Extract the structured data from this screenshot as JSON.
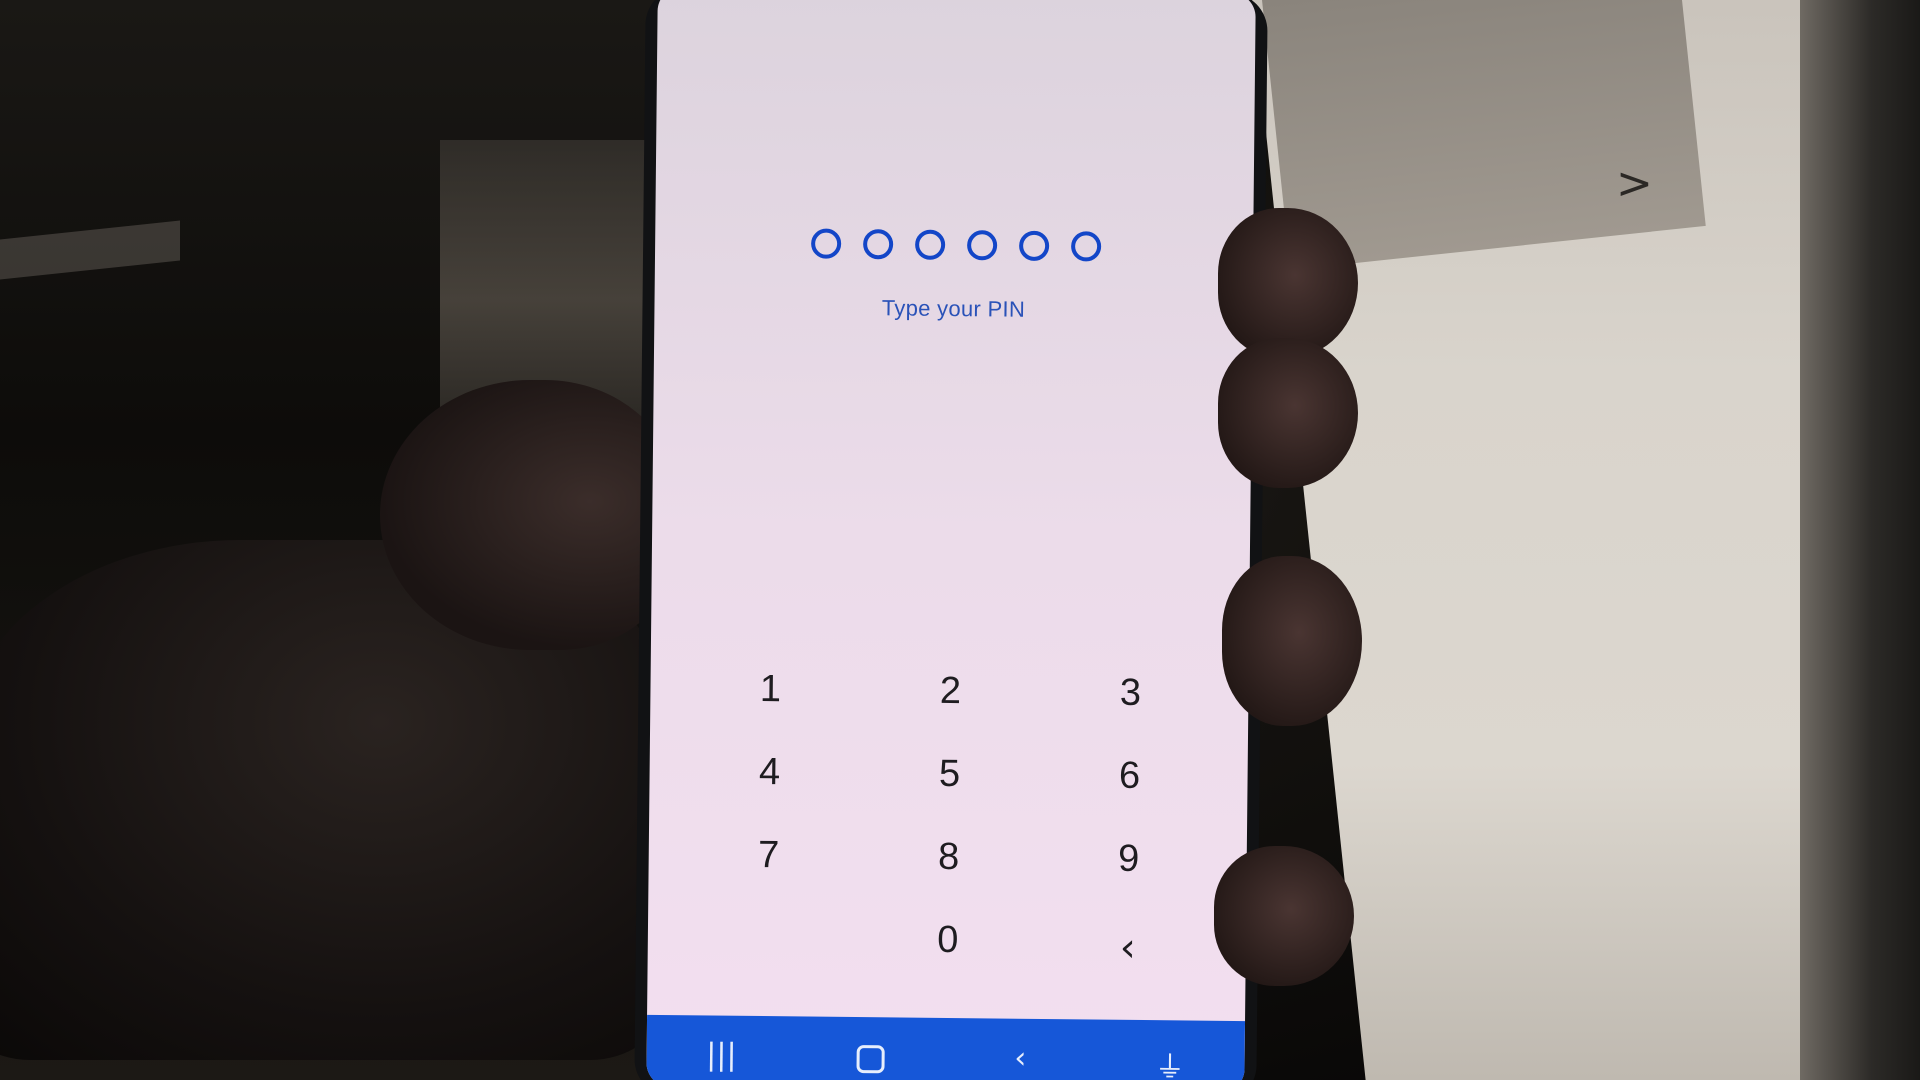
{
  "lock_screen": {
    "pin_length_slots": 6,
    "prompt": "Type your PIN",
    "accent_color": "#1346c8"
  },
  "keypad": {
    "keys": [
      "1",
      "2",
      "3",
      "4",
      "5",
      "6",
      "7",
      "8",
      "9",
      "",
      "0",
      "‹"
    ]
  },
  "navbar": {
    "recents_glyph": "|||",
    "back_glyph": "‹",
    "accessibility_glyph": "⏚",
    "color": "#1657d8"
  },
  "monitor": {
    "chevron": ">"
  }
}
